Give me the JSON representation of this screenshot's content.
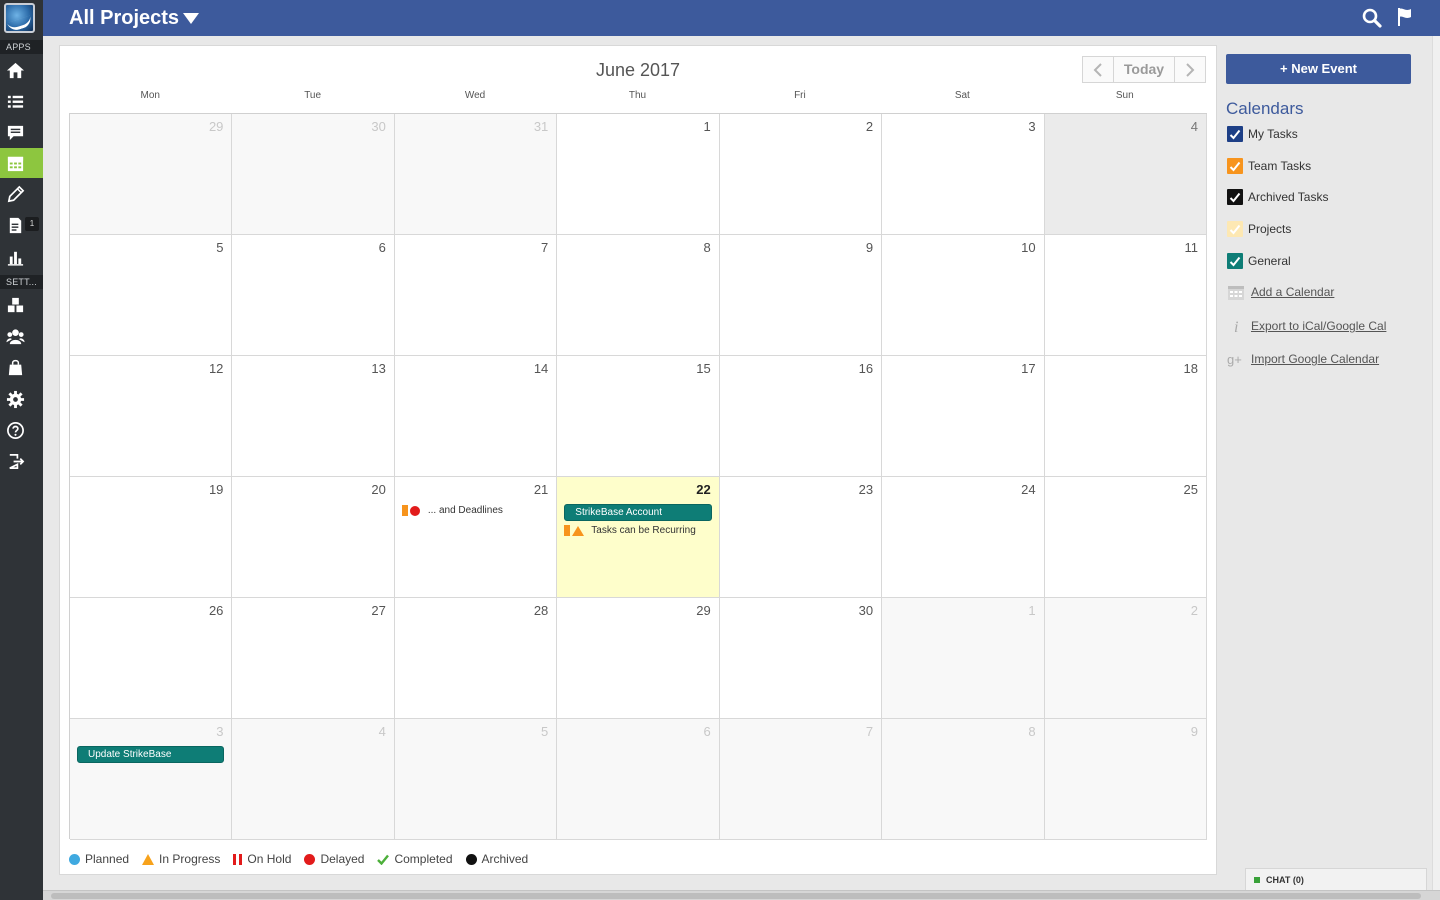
{
  "sidebar": {
    "apps_label": "APPS",
    "settings_label": "SETT...",
    "reports_badge": "1"
  },
  "header": {
    "project_title": "All Projects"
  },
  "calendar": {
    "month_title": "June 2017",
    "today_label": "Today",
    "weekdays": [
      "Mon",
      "Tue",
      "Wed",
      "Thu",
      "Fri",
      "Sat",
      "Sun"
    ],
    "weeks": [
      [
        "29",
        "30",
        "31",
        "1",
        "2",
        "3",
        "4"
      ],
      [
        "5",
        "6",
        "7",
        "8",
        "9",
        "10",
        "11"
      ],
      [
        "12",
        "13",
        "14",
        "15",
        "16",
        "17",
        "18"
      ],
      [
        "19",
        "20",
        "21",
        "22",
        "23",
        "24",
        "25"
      ],
      [
        "26",
        "27",
        "28",
        "29",
        "30",
        "1",
        "2"
      ],
      [
        "3",
        "4",
        "5",
        "6",
        "7",
        "8",
        "9"
      ]
    ],
    "events": {
      "wed_21_task": "... and Deadlines",
      "thu_22_event": "StrikeBase Account",
      "thu_22_task": "Tasks can be Recurring",
      "mon_3_event": "Update StrikeBase"
    }
  },
  "legend": [
    {
      "label": "Planned",
      "color": "#3fa9e0"
    },
    {
      "label": "In Progress",
      "color": "#f7a21b"
    },
    {
      "label": "On Hold",
      "color": "#e21b1b"
    },
    {
      "label": "Delayed",
      "color": "#e21b1b"
    },
    {
      "label": "Completed",
      "color": "#4caf3a"
    },
    {
      "label": "Archived",
      "color": "#111111"
    }
  ],
  "right_panel": {
    "new_event_label": "+ New Event",
    "calendars_title": "Calendars",
    "calendars": [
      {
        "label": "My Tasks",
        "color": "#1d3f86"
      },
      {
        "label": "Team Tasks",
        "color": "#f7941d"
      },
      {
        "label": "Archived Tasks",
        "color": "#111111"
      },
      {
        "label": "Projects",
        "color": "#fde8b3"
      },
      {
        "label": "General",
        "color": "#0e7d76"
      }
    ],
    "add_calendar": "Add a Calendar",
    "export_label": "Export to iCal/Google Cal",
    "import_label": "Import Google Calendar"
  },
  "chat": {
    "label": "CHAT (0)"
  },
  "colors": {
    "brand_blue": "#3d5a9c",
    "active_green": "#8dc63f",
    "event_teal": "#0e7d76",
    "today_yellow": "#fefecb"
  }
}
